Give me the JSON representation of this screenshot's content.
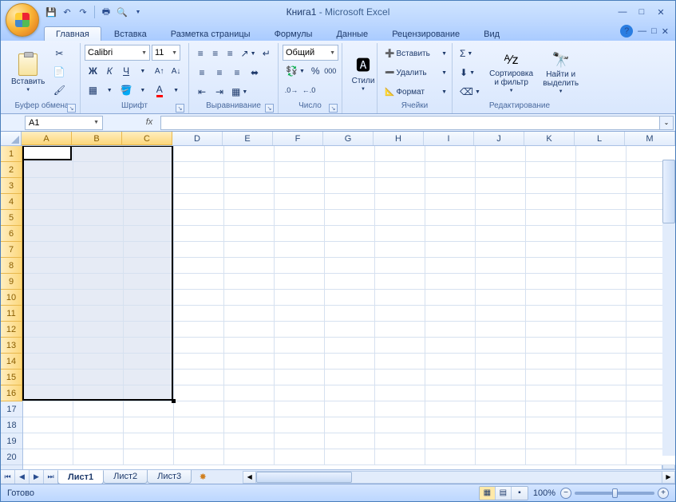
{
  "title": {
    "filename": "Книга1",
    "app": "Microsoft Excel"
  },
  "tabs": [
    "Главная",
    "Вставка",
    "Разметка страницы",
    "Формулы",
    "Данные",
    "Рецензирование",
    "Вид"
  ],
  "active_tab": 0,
  "ribbon": {
    "clipboard": {
      "label": "Буфер обмена",
      "paste": "Вставить"
    },
    "font": {
      "label": "Шрифт",
      "name": "Calibri",
      "size": "11"
    },
    "alignment": {
      "label": "Выравнивание"
    },
    "number": {
      "label": "Число",
      "format": "Общий"
    },
    "styles": {
      "label": "",
      "btn": "Стили"
    },
    "cells": {
      "label": "Ячейки",
      "insert": "Вставить",
      "delete": "Удалить",
      "format": "Формат"
    },
    "editing": {
      "label": "Редактирование",
      "sort": "Сортировка и фильтр",
      "find": "Найти и выделить"
    }
  },
  "namebox": "A1",
  "columns": [
    "A",
    "B",
    "C",
    "D",
    "E",
    "F",
    "G",
    "H",
    "I",
    "J",
    "K",
    "L",
    "M"
  ],
  "sel_cols": [
    "A",
    "B",
    "C"
  ],
  "rows_count": 20,
  "sel_rows_end": 16,
  "sheets": [
    "Лист1",
    "Лист2",
    "Лист3"
  ],
  "active_sheet": 0,
  "status": "Готово",
  "zoom": "100%"
}
